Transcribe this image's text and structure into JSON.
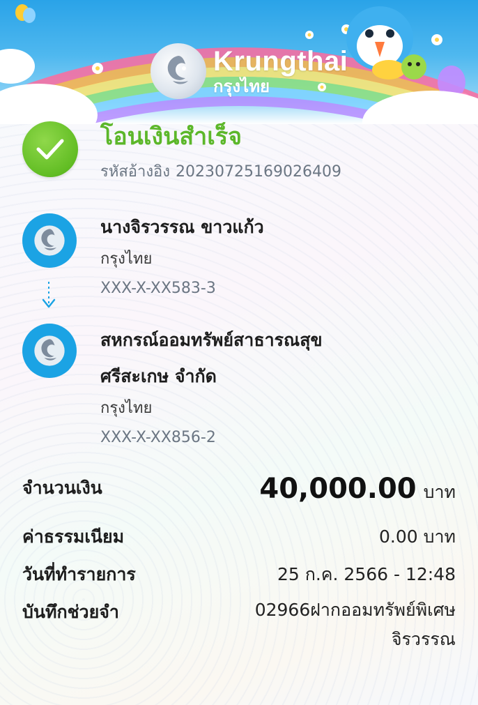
{
  "header": {
    "brand_en": "Krungthai",
    "brand_th": "กรุงไทย"
  },
  "status": {
    "title": "โอนเงินสำเร็จ",
    "ref_label": "รหัสอ้างอิง",
    "ref_value": "20230725169026409",
    "icon": "check-icon",
    "color": "#5cb72a"
  },
  "sender": {
    "name": "นางจิรวรรณ ขาวแก้ว",
    "bank": "กรุงไทย",
    "account": "XXX-X-XX583-3"
  },
  "receiver": {
    "name_line1": "สหกรณ์ออมทรัพย์สาธารณสุข",
    "name_line2": "ศรีสะเกษ จำกัด",
    "bank": "กรุงไทย",
    "account": "XXX-X-XX856-2"
  },
  "details": {
    "amount_label": "จำนวนเงิน",
    "amount_value": "40,000.00",
    "amount_unit": "บาท",
    "fee_label": "ค่าธรรมเนียม",
    "fee_value": "0.00 บาท",
    "date_label": "วันที่ทำรายการ",
    "date_value": "25 ก.ค. 2566 - 12:48",
    "memo_label": "บันทึกช่วยจำ",
    "memo_line1": "02966ฝากออมทรัพย์พิเศษ",
    "memo_line2": "จิรวรรณ"
  },
  "colors": {
    "accent_blue": "#1ba3e4",
    "success_green": "#62bd24"
  }
}
